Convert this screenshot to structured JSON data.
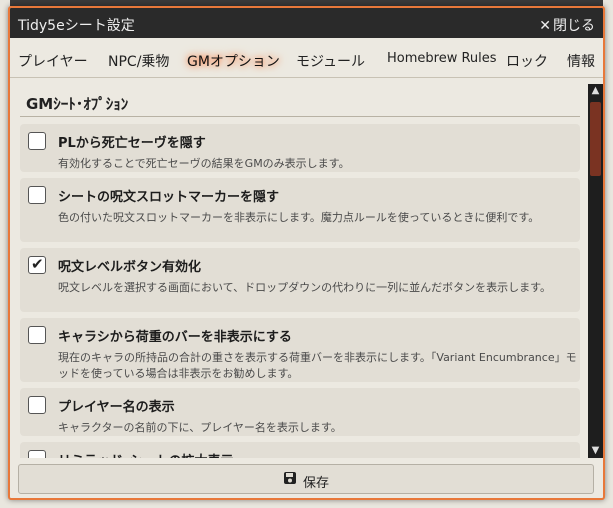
{
  "window": {
    "title": "Tidy5eシート設定",
    "close_label": "閉じる"
  },
  "tabs": [
    {
      "label": "プレイヤー"
    },
    {
      "label": "NPC/乗物"
    },
    {
      "label": "GMオプション",
      "active": true
    },
    {
      "label": "モジュール"
    },
    {
      "label": "Homebrew Rules"
    },
    {
      "label": "ロック"
    },
    {
      "label": "情報"
    }
  ],
  "section": {
    "title": "GMｼｰﾄ･ｵﾌﾟｼｮﾝ"
  },
  "options": [
    {
      "label": "PLから死亡セーヴを隠す",
      "desc": "有効化することで死亡セーヴの結果をGMのみ表示します。",
      "checked": false
    },
    {
      "label": "シートの呪文スロットマーカーを隠す",
      "desc": "色の付いた呪文スロットマーカーを非表示にします。魔力点ルールを使っているときに便利です。",
      "checked": false
    },
    {
      "label": "呪文レベルボタン有効化",
      "desc": "呪文レベルを選択する画面において、ドロップダウンの代わりに一列に並んだボタンを表示します。",
      "checked": true
    },
    {
      "label": "キャラシから荷重のバーを非表示にする",
      "desc": "現在のキャラの所持品の合計の重さを表示する荷重バーを非表示にします。「Variant Encumbrance」モッドを使っている場合は非表示をお勧めします。",
      "checked": false
    },
    {
      "label": "プレイヤー名の表示",
      "desc": "キャラクターの名前の下に、プレイヤー名を表示します。",
      "checked": false
    },
    {
      "label": "リミテッド･シートの拡大表示",
      "desc": "",
      "checked": false
    }
  ],
  "footer": {
    "save_label": "保存"
  },
  "colors": {
    "accent": "#e8783a",
    "titlebar": "#2a2a2a",
    "scroll_thumb": "#7a3322"
  }
}
